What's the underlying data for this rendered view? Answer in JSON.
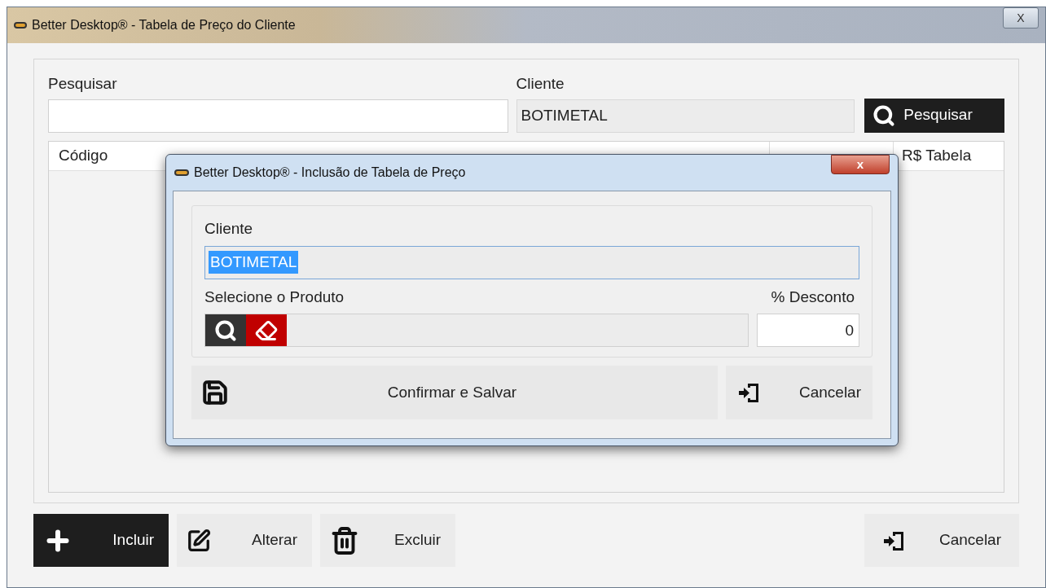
{
  "window": {
    "title": "Better Desktop® - Tabela de Preço do Cliente",
    "close": "X"
  },
  "search": {
    "label": "Pesquisar"
  },
  "client": {
    "label": "Cliente",
    "value": "BOTIMETAL"
  },
  "search_button": "Pesquisar",
  "table": {
    "column_1": "Código",
    "column_4": "R$ Tabela"
  },
  "actions": [
    {
      "label": "Incluir",
      "kind": "add",
      "selected": true
    },
    {
      "label": "Alterar",
      "kind": "edit",
      "selected": false
    },
    {
      "label": "Excluir",
      "kind": "delete",
      "selected": false
    }
  ],
  "cancel_button": "Cancelar",
  "dialog": {
    "title": "Better Desktop® - Inclusão de Tabela de Preço",
    "close": "x",
    "client_label": "Cliente",
    "client_value": "BOTIMETAL",
    "client_value_selected": true,
    "product_label": "Selecione o Produto",
    "discount_label": "% Desconto",
    "discount_value": "0",
    "confirm_button": "Confirmar e Salvar",
    "cancel_button": "Cancelar"
  }
}
